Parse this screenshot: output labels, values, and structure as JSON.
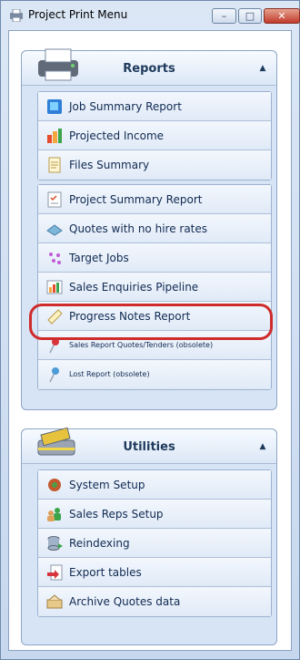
{
  "window": {
    "title": "Project Print Menu",
    "minimize_icon": "minimize-icon",
    "maximize_icon": "maximize-icon",
    "close_icon": "close-icon"
  },
  "reports": {
    "title": "Reports",
    "group_a": [
      {
        "label": "Job Summary Report",
        "icon": "book-icon"
      },
      {
        "label": "Projected Income",
        "icon": "bar-chart-icon"
      },
      {
        "label": "Files Summary",
        "icon": "document-icon"
      }
    ],
    "group_b": [
      {
        "label": "Project Summary Report",
        "icon": "checklist-icon"
      },
      {
        "label": "Quotes with no hire rates",
        "icon": "quote-icon"
      },
      {
        "label": "Target Jobs",
        "icon": "target-icon"
      },
      {
        "label": "Sales Enquiries Pipeline",
        "icon": "pipeline-icon"
      },
      {
        "label": "Progress Notes Report",
        "icon": "notes-icon"
      },
      {
        "label": "Sales Report Quotes/Tenders (obsolete)",
        "icon": "pin-red-icon"
      },
      {
        "label": "Lost Report (obsolete)",
        "icon": "pin-blue-icon"
      }
    ]
  },
  "utilities": {
    "title": "Utilities",
    "items": [
      {
        "label": "System Setup",
        "icon": "setup-icon"
      },
      {
        "label": "Sales Reps Setup",
        "icon": "users-icon"
      },
      {
        "label": "Reindexing",
        "icon": "reindex-icon"
      },
      {
        "label": "Export tables",
        "icon": "export-icon"
      },
      {
        "label": "Archive Quotes data",
        "icon": "archive-icon"
      }
    ]
  }
}
